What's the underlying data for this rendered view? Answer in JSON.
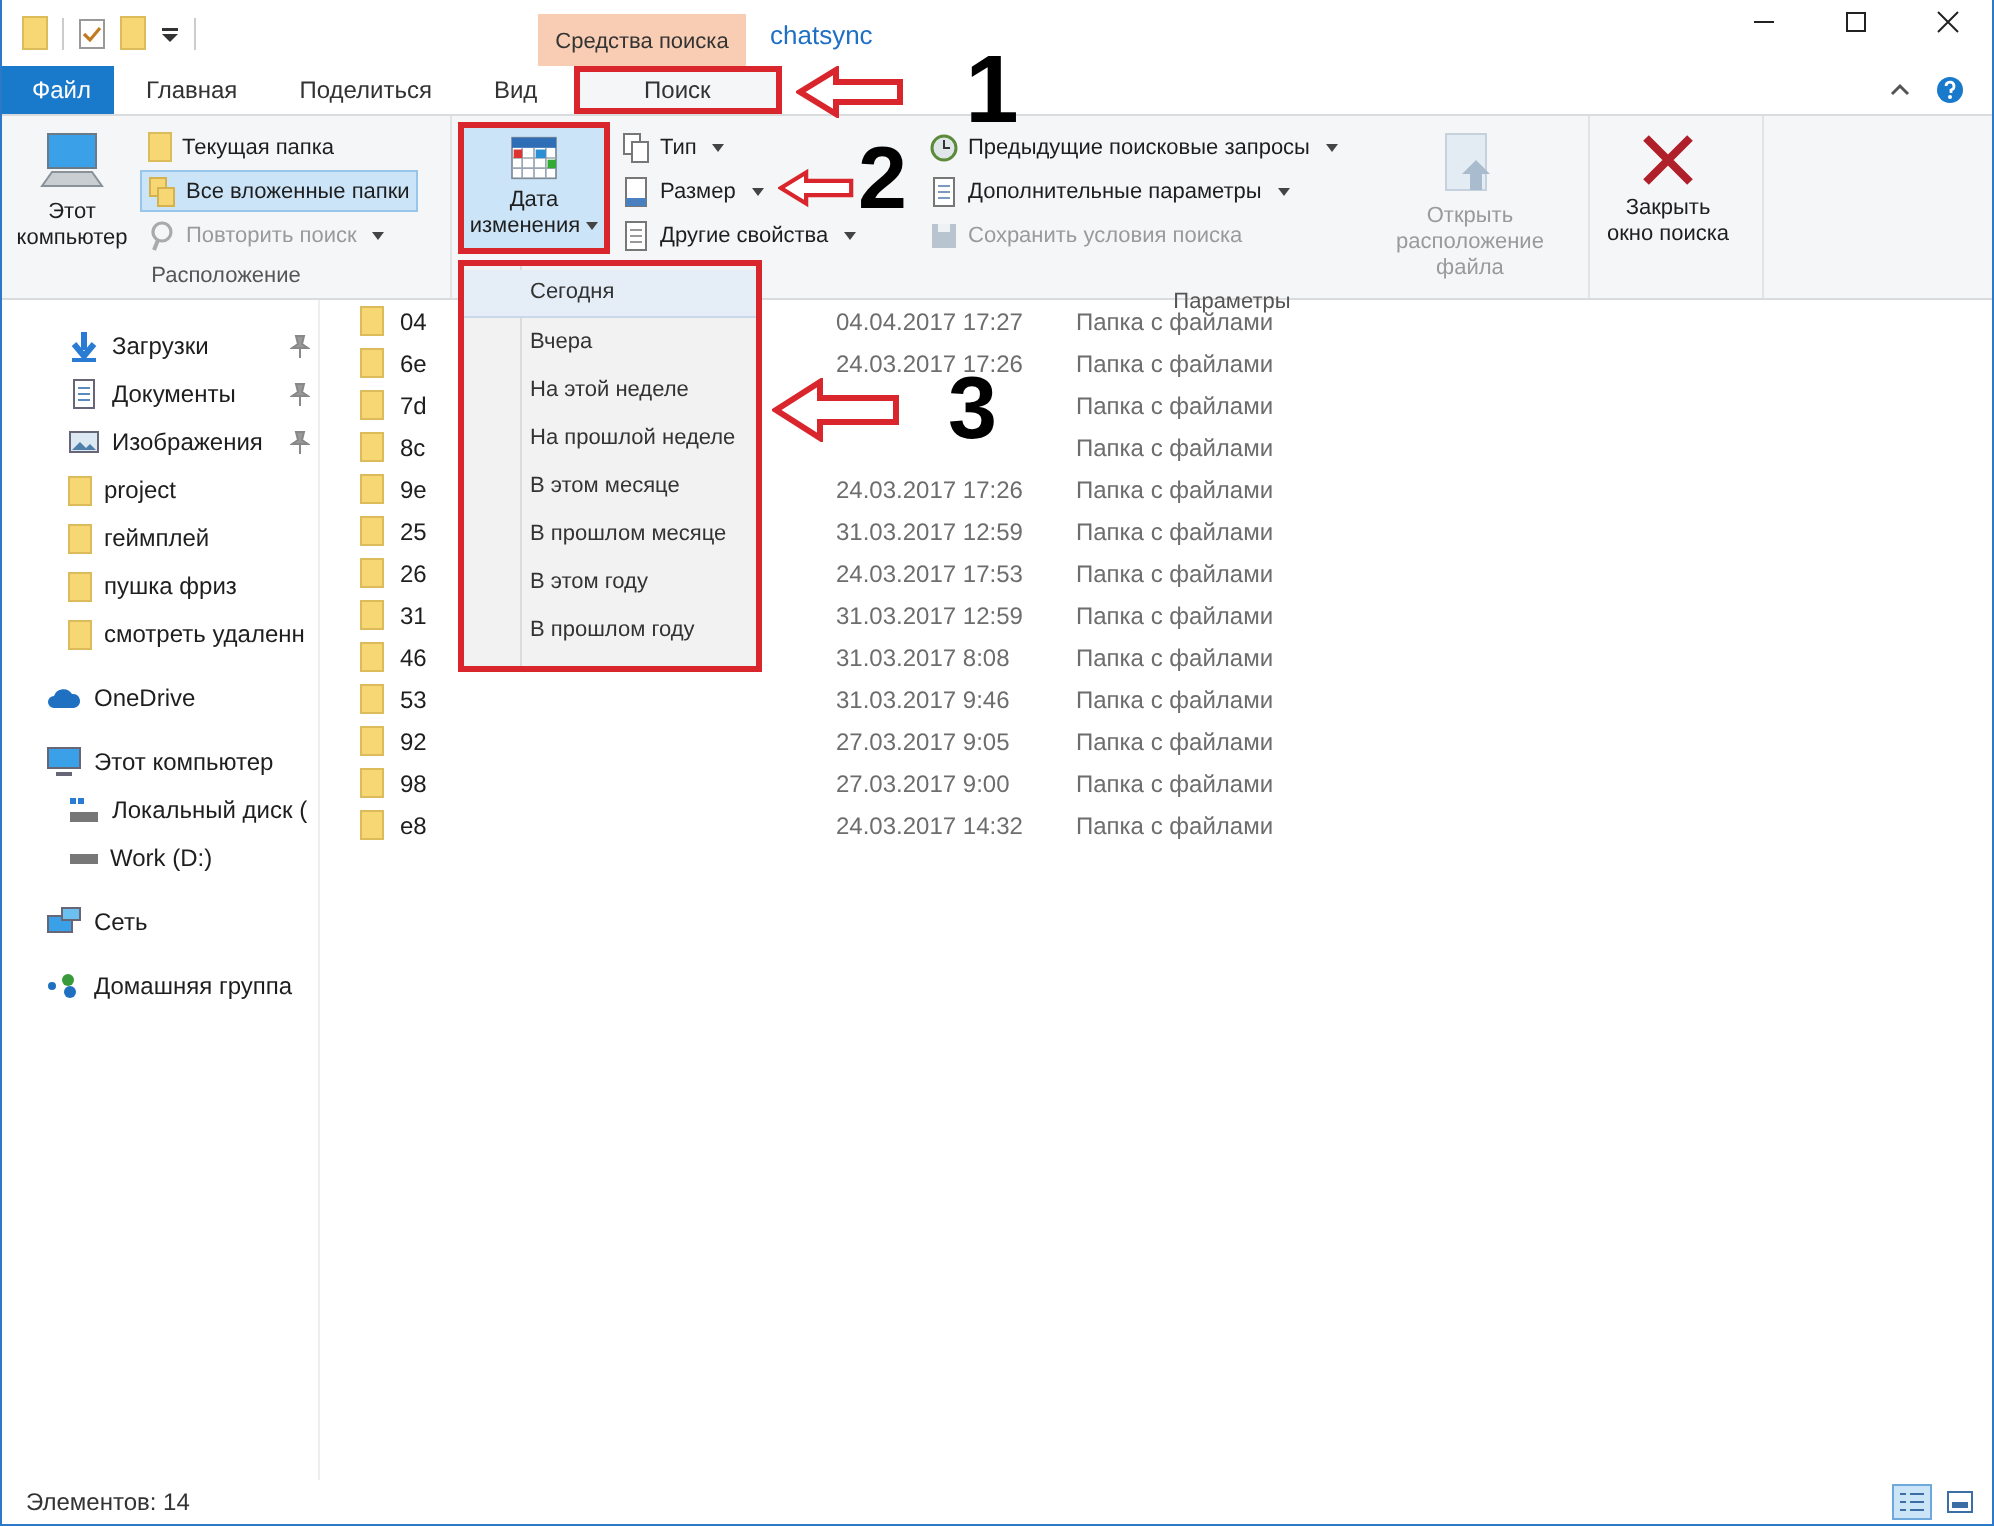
{
  "window": {
    "title": "chatsync",
    "context_tab_group": "Средства поиска"
  },
  "ribbon_tabs": [
    {
      "label": "Файл",
      "kind": "file",
      "selected": false
    },
    {
      "label": "Главная",
      "kind": "tab",
      "selected": false
    },
    {
      "label": "Поделиться",
      "kind": "tab",
      "selected": false
    },
    {
      "label": "Вид",
      "kind": "tab",
      "selected": false
    },
    {
      "label": "Поиск",
      "kind": "tab",
      "selected": true,
      "callout": "1"
    }
  ],
  "ribbon": {
    "location_group": {
      "label": "Расположение",
      "this_pc": "Этот компьютер",
      "items": [
        {
          "label": "Текущая папка",
          "kind": "folder",
          "selected": false,
          "disabled": false,
          "dropdown": false
        },
        {
          "label": "Все вложенные папки",
          "kind": "subfolders",
          "selected": true,
          "disabled": false,
          "dropdown": false
        },
        {
          "label": "Повторить поиск",
          "kind": "repeat",
          "selected": false,
          "disabled": true,
          "dropdown": true
        }
      ]
    },
    "refine_group": {
      "date_button": {
        "label": "Дата изменения",
        "selected": true,
        "callout": "2"
      },
      "items": [
        {
          "label": "Тип",
          "kind": "type",
          "dropdown": true
        },
        {
          "label": "Размер",
          "kind": "size",
          "dropdown": true
        },
        {
          "label": "Другие свойства",
          "kind": "props",
          "dropdown": true
        }
      ]
    },
    "options_group": {
      "label": "Параметры",
      "items": [
        {
          "label": "Предыдущие поисковые запросы",
          "kind": "recent",
          "disabled": false,
          "dropdown": true
        },
        {
          "label": "Дополнительные параметры",
          "kind": "options",
          "disabled": false,
          "dropdown": true
        },
        {
          "label": "Сохранить условия поиска",
          "kind": "save",
          "disabled": true,
          "dropdown": false
        }
      ],
      "open_location": {
        "label": "Открыть расположение файла",
        "disabled": true
      }
    },
    "close_button": {
      "label": "Закрыть окно поиска"
    }
  },
  "date_menu": {
    "callout": "3",
    "items": [
      {
        "label": "Сегодня",
        "selected": true
      },
      {
        "label": "Вчера",
        "selected": false
      },
      {
        "label": "На этой неделе",
        "selected": false
      },
      {
        "label": "На прошлой неделе",
        "selected": false
      },
      {
        "label": "В этом месяце",
        "selected": false
      },
      {
        "label": "В прошлом месяце",
        "selected": false
      },
      {
        "label": "В этом году",
        "selected": false
      },
      {
        "label": "В прошлом году",
        "selected": false
      }
    ]
  },
  "nav": {
    "quick_items": [
      {
        "label": "Загрузки",
        "kind": "downloads",
        "pinned": true
      },
      {
        "label": "Документы",
        "kind": "documents",
        "pinned": true
      },
      {
        "label": "Изображения",
        "kind": "images",
        "pinned": true
      },
      {
        "label": "project",
        "kind": "folder",
        "pinned": false
      },
      {
        "label": "геймплей",
        "kind": "folder",
        "pinned": false
      },
      {
        "label": "пушка фриз",
        "kind": "folder",
        "pinned": false
      },
      {
        "label": "смотреть удаленн",
        "kind": "folder",
        "pinned": false
      }
    ],
    "roots": [
      {
        "label": "OneDrive",
        "kind": "cloud"
      },
      {
        "label": "Этот компьютер",
        "kind": "computer",
        "children": [
          {
            "label": "Локальный диск (",
            "kind": "os-drive"
          },
          {
            "label": "Work (D:)",
            "kind": "drive"
          }
        ]
      },
      {
        "label": "Сеть",
        "kind": "network"
      },
      {
        "label": "Домашняя группа",
        "kind": "homegroup"
      }
    ]
  },
  "files": [
    {
      "name": "04",
      "date": "04.04.2017 17:27",
      "type": "Папка с файлами"
    },
    {
      "name": "6e",
      "date": "24.03.2017 17:26",
      "type": "Папка с файлами"
    },
    {
      "name": "7d",
      "type": "Папка с файлами"
    },
    {
      "name": "8c",
      "type": "Папка с файлами"
    },
    {
      "name": "9e",
      "date": "24.03.2017 17:26",
      "type": "Папка с файлами"
    },
    {
      "name": "25",
      "date": "31.03.2017 12:59",
      "type": "Папка с файлами"
    },
    {
      "name": "26",
      "date": "24.03.2017 17:53",
      "type": "Папка с файлами"
    },
    {
      "name": "31",
      "date": "31.03.2017 12:59",
      "type": "Папка с файлами"
    },
    {
      "name": "46",
      "date": "31.03.2017 8:08",
      "type": "Папка с файлами"
    },
    {
      "name": "53",
      "date": "31.03.2017 9:46",
      "type": "Папка с файлами"
    },
    {
      "name": "92",
      "date": "27.03.2017 9:05",
      "type": "Папка с файлами"
    },
    {
      "name": "98",
      "date": "27.03.2017 9:00",
      "type": "Папка с файлами"
    },
    {
      "name": "e8",
      "date": "24.03.2017 14:32",
      "type": "Папка с файлами"
    }
  ],
  "status_bar": {
    "count": "Элементов: 14",
    "views": [
      {
        "kind": "details",
        "selected": true
      },
      {
        "kind": "large-icons",
        "selected": false
      }
    ]
  }
}
